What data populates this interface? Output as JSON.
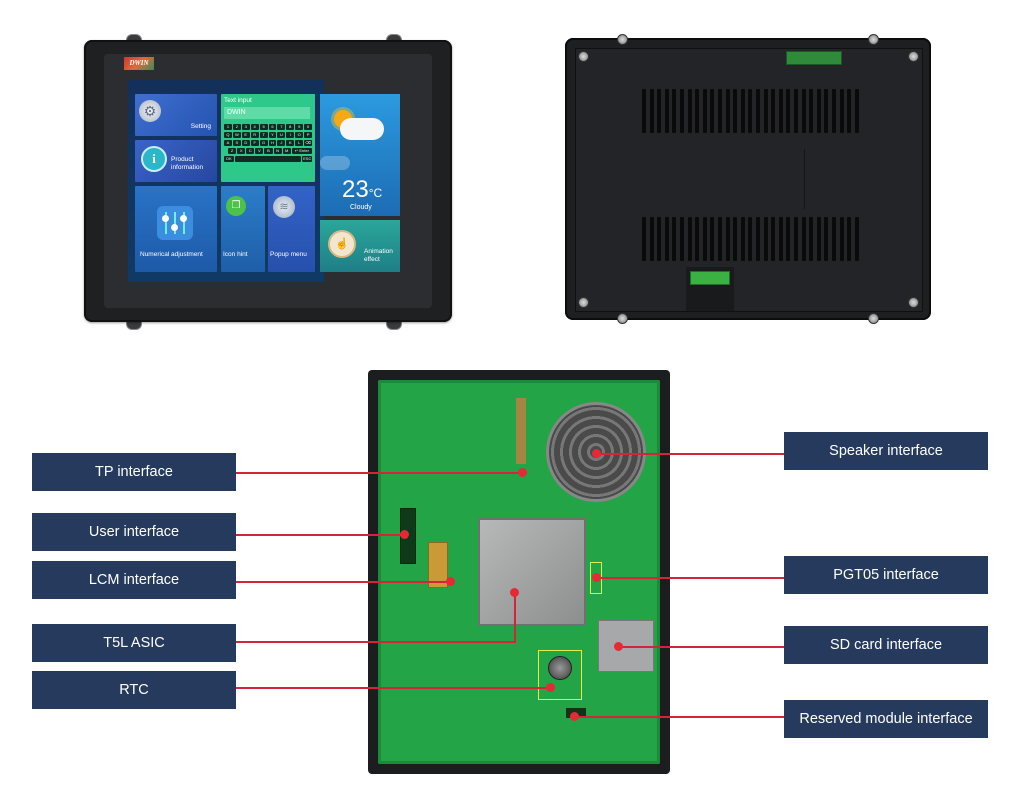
{
  "front_view": {
    "brand_logo": "DWIN",
    "screen": {
      "tiles": {
        "setting": "Setting",
        "product_information": "Product information",
        "numerical_adjustment": "Numerical adjustment",
        "text_input_title": "Text input",
        "text_input_value": "DWIN",
        "icon_hint": "Icon hint",
        "popup_menu": "Popup menu",
        "weather_temperature": "23",
        "weather_unit": "°C",
        "weather_condition": "Cloudy",
        "animation_effect": "Animation effect"
      },
      "keyboard_rows": [
        [
          "1",
          "2",
          "3",
          "4",
          "5",
          "6",
          "7",
          "8",
          "9",
          "0"
        ],
        [
          "Q",
          "W",
          "E",
          "R",
          "T",
          "Y",
          "U",
          "I",
          "O",
          "P"
        ],
        [
          "A",
          "S",
          "D",
          "F",
          "G",
          "H",
          "J",
          "K",
          "L",
          "⌫"
        ],
        [
          "Z",
          "X",
          "C",
          "V",
          "B",
          "N",
          "M",
          "↵ Enter"
        ],
        [
          "OK",
          "",
          "ESC"
        ]
      ]
    }
  },
  "back_view": {},
  "pcb_view": {
    "callouts_left": [
      {
        "label": "TP interface"
      },
      {
        "label": "User interface"
      },
      {
        "label": "LCM interface"
      },
      {
        "label": "T5L ASIC"
      },
      {
        "label": "RTC"
      }
    ],
    "callouts_right": [
      {
        "label": "Speaker interface"
      },
      {
        "label": "PGT05 interface"
      },
      {
        "label": "SD card interface"
      },
      {
        "label": "Reserved module interface"
      }
    ]
  },
  "colors": {
    "label_bg": "#263a5e",
    "callout_line": "#d3253a",
    "pcb_green": "#22a447",
    "keyboard_green": "#2ec98a"
  }
}
